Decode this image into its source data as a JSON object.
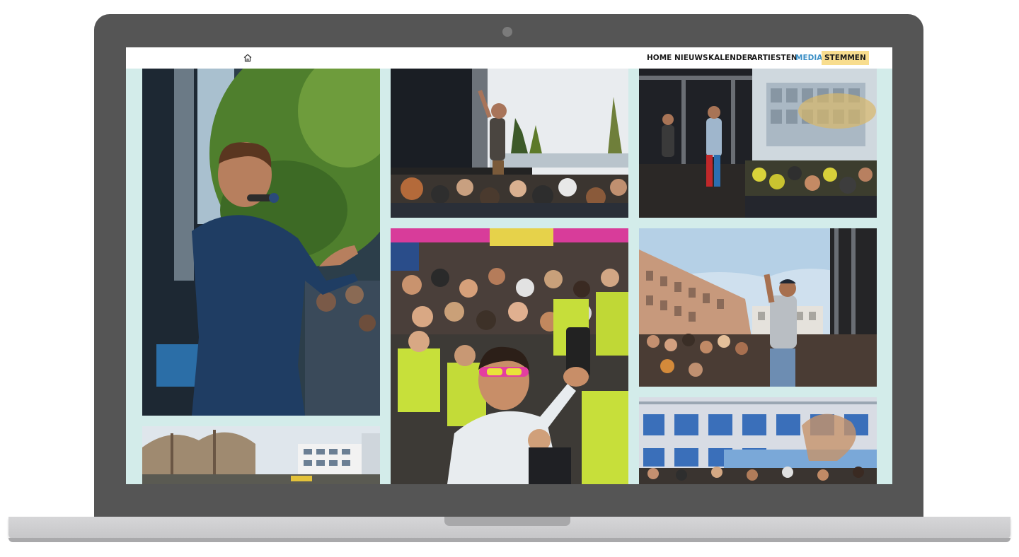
{
  "nav": {
    "home_icon": "home-icon",
    "items": [
      {
        "label": "HOME"
      },
      {
        "label": "NIEUWS"
      },
      {
        "label": "KALENDER"
      },
      {
        "label": "ARTIESTEN"
      },
      {
        "label": "MEDIA",
        "active": true
      },
      {
        "label": "STEMMEN",
        "highlight": true
      }
    ],
    "active_color": "#3b8fc6",
    "highlight_color": "#f8dd8e"
  },
  "colors": {
    "page_background": "#d3ecea",
    "laptop_frame": "#555555"
  },
  "gallery": {
    "photos": [
      {
        "name": "photo-singer-blue-tracksuit"
      },
      {
        "name": "photo-performer-on-stage-crowd"
      },
      {
        "name": "photo-stage-confetti-crowd"
      },
      {
        "name": "photo-outdoor-festival-trees"
      },
      {
        "name": "photo-crowd-selfie"
      },
      {
        "name": "photo-rapper-school-building"
      },
      {
        "name": "photo-school-building-crowd"
      }
    ]
  }
}
